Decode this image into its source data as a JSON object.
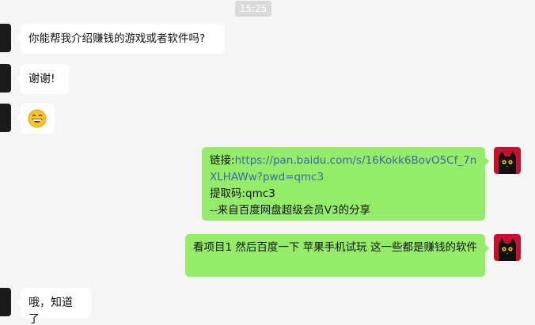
{
  "timestamp": "15:25",
  "messages": [
    {
      "side": "left",
      "text": "你能帮我介绍赚钱的游戏或者软件吗?"
    },
    {
      "side": "left",
      "text": "谢谢!"
    },
    {
      "side": "left",
      "emoji": "grinning-face-emoji"
    },
    {
      "side": "right",
      "link_label": "链接:",
      "link_url": "https://pan.baidu.com/s/16Kokk6BovO5Cf_7nXLHAWw?pwd=qmc3",
      "code_line": "提取码:qmc3",
      "source_line": "--来自百度网盘超级会员V3的分享"
    },
    {
      "side": "right",
      "text": "看项目1  然后百度一下 苹果手机试玩 这一些都是赚钱的软件"
    },
    {
      "side": "left",
      "text": "哦，知道了"
    }
  ],
  "colors": {
    "background": "#f5f5f5",
    "bubble_left": "#ffffff",
    "bubble_right": "#95ec69",
    "link": "#3b6ba5",
    "timestamp_bg": "#dadada",
    "avatar_cat_bg": "#c8102e"
  }
}
